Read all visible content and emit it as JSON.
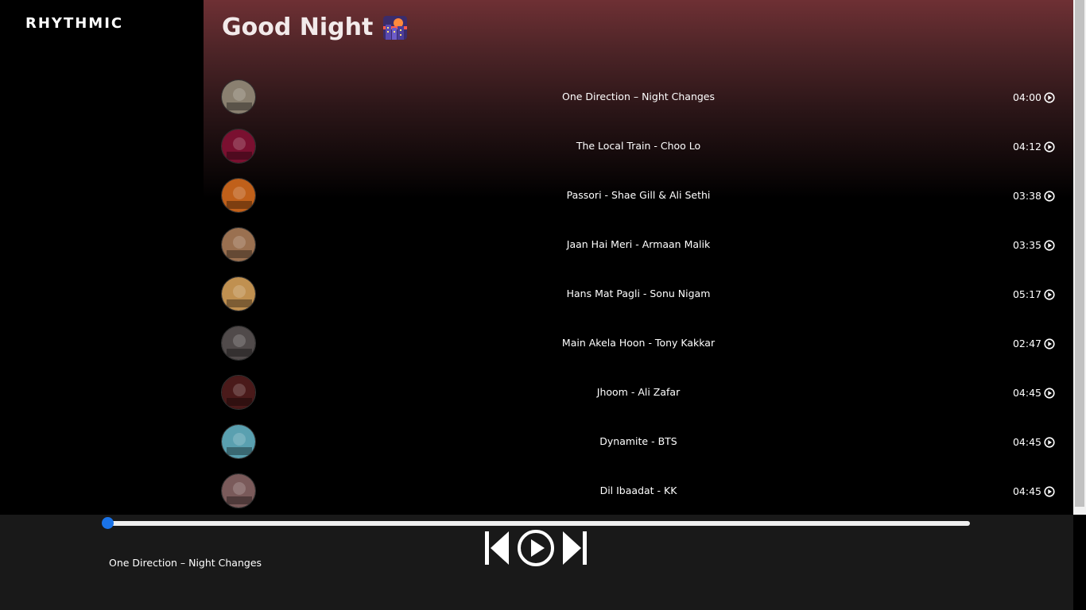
{
  "app": {
    "logo": "RHYTHMIC"
  },
  "header": {
    "title": "Good Night"
  },
  "songs": [
    {
      "name": "One Direction – Night Changes",
      "duration": "04:00",
      "cover_color": "#8a8070"
    },
    {
      "name": "The Local Train - Choo Lo",
      "duration": "04:12",
      "cover_color": "#7a1030"
    },
    {
      "name": "Passori - Shae Gill & Ali Sethi",
      "duration": "03:38",
      "cover_color": "#c0601a"
    },
    {
      "name": "Jaan Hai Meri - Armaan Malik",
      "duration": "03:35",
      "cover_color": "#9a7050"
    },
    {
      "name": "Hans Mat Pagli - Sonu Nigam",
      "duration": "05:17",
      "cover_color": "#c09050"
    },
    {
      "name": "Main Akela Hoon - Tony Kakkar",
      "duration": "02:47",
      "cover_color": "#504a4a"
    },
    {
      "name": "Jhoom - Ali Zafar",
      "duration": "04:45",
      "cover_color": "#4a1a1a"
    },
    {
      "name": "Dynamite - BTS",
      "duration": "04:45",
      "cover_color": "#5aa0b0"
    },
    {
      "name": "Dil Ibaadat - KK",
      "duration": "04:45",
      "cover_color": "#7a5a5a"
    }
  ],
  "player": {
    "now_playing": "One Direction – Night Changes",
    "progress": 0,
    "accent_color": "#1a73e8"
  },
  "icons": {
    "play_small": "play-circle-icon",
    "prev": "previous-icon",
    "play": "play-icon",
    "next": "next-icon"
  }
}
